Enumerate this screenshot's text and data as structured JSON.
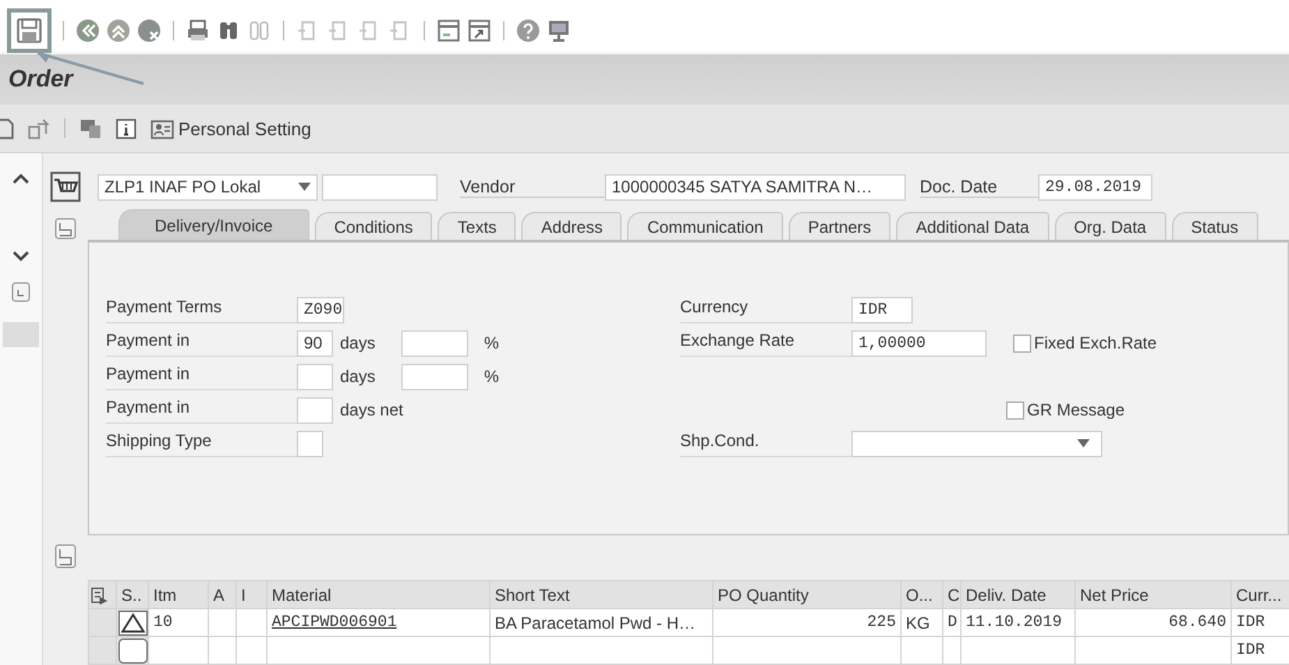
{
  "system_toolbar": {
    "save_highlighted": true
  },
  "title_bar": {
    "title": "Order"
  },
  "app_toolbar": {
    "personal_setting": "Personal Setting"
  },
  "header": {
    "order_type": "ZLP1 INAF PO Lokal",
    "vendor_label": "Vendor",
    "vendor": "1000000345 SATYA SAMITRA N…",
    "doc_date_label": "Doc. Date",
    "doc_date": "29.08.2019"
  },
  "tabs": [
    {
      "label": "Delivery/Invoice",
      "selected": true
    },
    {
      "label": "Conditions",
      "selected": false
    },
    {
      "label": "Texts",
      "selected": false
    },
    {
      "label": "Address",
      "selected": false
    },
    {
      "label": "Communication",
      "selected": false
    },
    {
      "label": "Partners",
      "selected": false
    },
    {
      "label": "Additional Data",
      "selected": false
    },
    {
      "label": "Org. Data",
      "selected": false
    },
    {
      "label": "Status",
      "selected": false
    }
  ],
  "form_left": [
    {
      "kind": "terms",
      "label": "Payment Terms",
      "value": "Z090"
    },
    {
      "kind": "discount",
      "label": "Payment in",
      "days": "90",
      "days_unit": "days",
      "percent_unit": "%"
    },
    {
      "kind": "discount",
      "label": "Payment in",
      "days_unit": "days",
      "percent_unit": "%"
    },
    {
      "kind": "net",
      "label": "Payment in",
      "days_unit": "days net"
    },
    {
      "kind": "code",
      "label": "Shipping Type"
    }
  ],
  "form_right": [
    {
      "kind": "text",
      "label": "Currency",
      "value": "IDR"
    },
    {
      "kind": "rate",
      "label": "Exchange Rate",
      "value": "1,00000",
      "checkbox": {
        "label": "Fixed Exch.Rate",
        "checked": false
      }
    },
    {
      "kind": "blank"
    },
    {
      "kind": "checkbox",
      "label": "GR Message",
      "checked": false
    },
    {
      "kind": "dropdown",
      "label": "Shp.Cond."
    }
  ],
  "table": {
    "columns": [
      "S..",
      "Itm",
      "A",
      "I",
      "Material",
      "Short Text",
      "PO Quantity",
      "O...",
      "C",
      "Deliv. Date",
      "Net Price",
      "Curr..."
    ],
    "rows": [
      {
        "kind": "warning",
        "cells": [
          null,
          "10",
          null,
          null,
          "APCIPWD006901",
          "BA Paracetamol Pwd - H…",
          "225",
          "KG",
          "D",
          "11.10.2019",
          "68.640",
          "IDR"
        ]
      },
      {
        "kind": "empty",
        "cells": [
          null,
          null,
          null,
          null,
          null,
          null,
          null,
          null,
          null,
          null,
          null,
          "IDR"
        ]
      }
    ]
  }
}
